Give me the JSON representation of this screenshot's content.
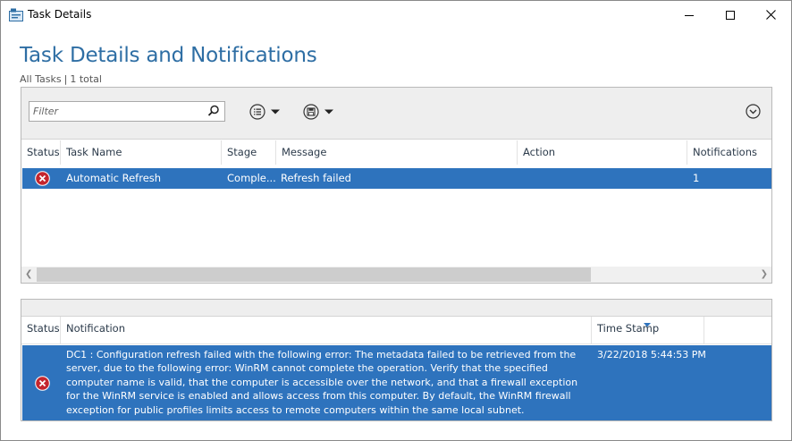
{
  "window": {
    "title": "Task Details",
    "controls": {
      "minimize_icon": "minimize-icon",
      "maximize_icon": "maximize-icon",
      "close_icon": "close-icon"
    }
  },
  "header": {
    "title": "Task Details and Notifications",
    "scope": "All Tasks",
    "separator": "|",
    "count": "1 total"
  },
  "toolbar": {
    "filter_placeholder": "Filter",
    "filter_icon": "search-icon",
    "list_button_icon": "list-options-icon",
    "save_button_icon": "save-query-icon",
    "expand_icon": "chevron-down-circle-icon"
  },
  "tasks": {
    "columns": [
      "Status",
      "Task Name",
      "Stage",
      "Message",
      "Action",
      "Notifications"
    ],
    "rows": [
      {
        "status_icon": "error-icon",
        "task_name": "Automatic Refresh",
        "stage": "Comple...",
        "message": "Refresh failed",
        "action": "",
        "notifications": "1"
      }
    ]
  },
  "notifications": {
    "columns": [
      "Status",
      "Notification",
      "Time Stamp"
    ],
    "rows": [
      {
        "status_icon": "error-icon",
        "notification": "DC1 : Configuration refresh failed with the following error: The metadata failed to be retrieved from the server, due to the following error: WinRM cannot complete the operation. Verify that the specified computer name is valid, that the computer is accessible over the network, and that a firewall exception for the WinRM service is enabled and allows access from this computer. By default, the WinRM firewall exception for public profiles limits access to remote computers within the same local subnet.",
        "time_stamp": "3/22/2018 5:44:53 PM"
      }
    ]
  },
  "colors": {
    "accent": "#2e6ea4",
    "selection": "#2e73bd",
    "error": "#c4262e"
  }
}
